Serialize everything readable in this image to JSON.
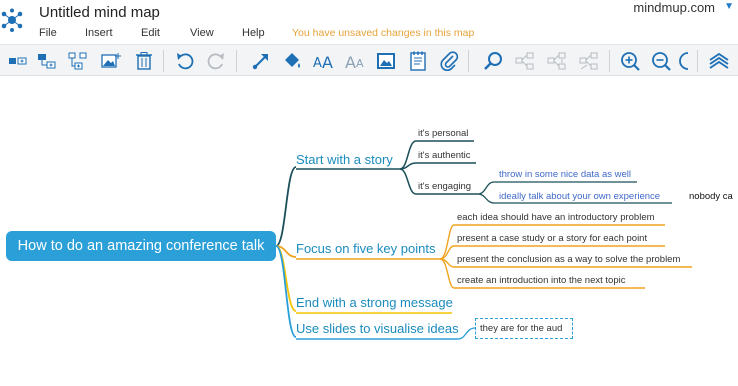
{
  "header": {
    "title": "Untitled mind map",
    "brand": "mindmup.com",
    "brand_arrow": "▼",
    "unsaved_notice": "You have unsaved changes in this map"
  },
  "menu": {
    "file": "File",
    "insert": "Insert",
    "edit": "Edit",
    "view": "View",
    "help": "Help"
  },
  "toolbar": {
    "icons": [
      "add-sibling-icon",
      "add-child-icon",
      "add-node-tree-icon",
      "insert-image-icon",
      "delete-icon",
      "undo-icon",
      "redo-icon",
      "connect-arrow-icon",
      "fill-color-icon",
      "font-size-increase-icon",
      "font-size-decrease-icon",
      "image-frame-icon",
      "note-icon",
      "attachment-icon",
      "search-icon",
      "collapse-icon",
      "expand-icon",
      "toggle-icon",
      "zoom-in-icon",
      "zoom-out-icon",
      "zoom-fit-icon",
      "layers-icon"
    ]
  },
  "colors": {
    "root": "#2a9fd8",
    "story": "#1b4f59",
    "story_text": "#1a8bbd",
    "focus": "#f0a31f",
    "end": "#f5c400",
    "slides": "#2a9fd8",
    "highlight": "#4169c9",
    "accent_orange": "#e6a33a"
  },
  "map": {
    "root": "How to do an amazing conference talk",
    "branches": [
      {
        "label": "Start with a story",
        "children": [
          {
            "label": "it's personal"
          },
          {
            "label": "it's authentic"
          },
          {
            "label": "it's engaging",
            "children": [
              {
                "label": "throw in some nice data as well"
              },
              {
                "label": "ideally talk about your own experience"
              }
            ]
          }
        ],
        "overflow": "nobody ca"
      },
      {
        "label": "Focus on five key points",
        "children": [
          {
            "label": "each idea should have an introductory problem"
          },
          {
            "label": "present a case study or a story for each point"
          },
          {
            "label": "present the conclusion as a way to solve the problem"
          },
          {
            "label": "create an introduction into the next topic"
          }
        ]
      },
      {
        "label": "End with a strong message"
      },
      {
        "label": "Use slides to visualise ideas",
        "editing_text": "they are for the aud"
      }
    ]
  }
}
